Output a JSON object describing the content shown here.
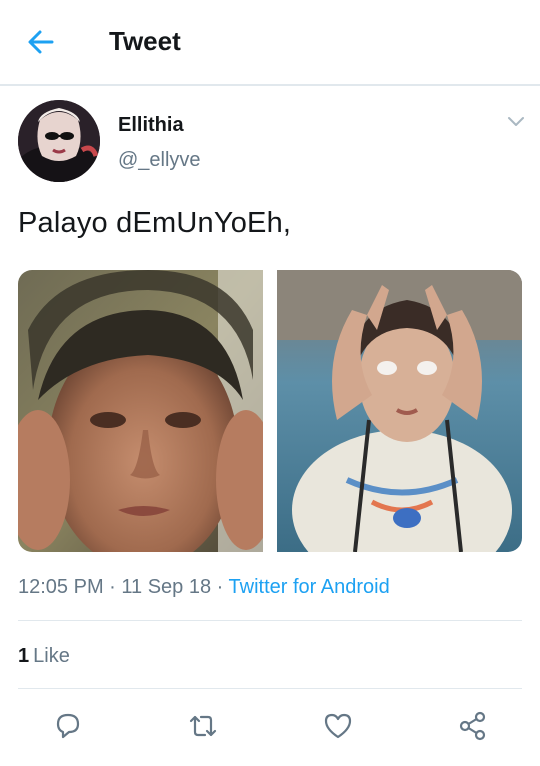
{
  "header": {
    "title": "Tweet",
    "back_icon": "arrow-left-icon"
  },
  "author": {
    "display_name": "Ellithia",
    "handle": "@_ellyve",
    "menu_icon": "chevron-down-icon"
  },
  "tweet": {
    "text": "Palayo dEmUnYoEh,",
    "time": "12:05 PM",
    "date": "11 Sep 18",
    "separator": " · ",
    "source": "Twitter for Android",
    "media": [
      {
        "name": "photo-boy-covering-ears"
      },
      {
        "name": "photo-girl-rolled-eyes"
      }
    ]
  },
  "stats": {
    "like_count": "1",
    "like_label": "Like"
  },
  "actions": [
    {
      "name": "reply-icon"
    },
    {
      "name": "retweet-icon"
    },
    {
      "name": "like-icon"
    },
    {
      "name": "share-icon"
    }
  ],
  "colors": {
    "accent": "#1da1f2",
    "text_primary": "#14171a",
    "text_secondary": "#657786",
    "divider": "#e1e8ed"
  }
}
